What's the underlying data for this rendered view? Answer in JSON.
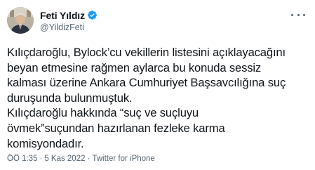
{
  "author": {
    "display_name": "Feti Yıldız",
    "handle": "@YildizFeti",
    "verified": true
  },
  "tweet": {
    "lines": [
      "Kılıçdaroğlu, Bylock’cu vekillerin listesini açıklayacağını",
      "beyan etmesine rağmen aylarca bu konuda sessiz",
      "kalması üzerine Ankara Cumhuriyet Başsavcılığına suç",
      "duruşunda bulunmuştuk.",
      "Kılıçdaroğlu hakkında “suç ve suçluyu",
      "övmek”suçundan hazırlanan fezleke karma",
      "komisyondadır."
    ]
  },
  "meta": {
    "time": "ÖÖ 1:35",
    "separator": "·",
    "date": "5 Kas 2022",
    "source": "Twitter for iPhone"
  },
  "colors": {
    "text": "#0f1419",
    "secondary": "#536471",
    "verified_badge": "#1d9bf0"
  }
}
